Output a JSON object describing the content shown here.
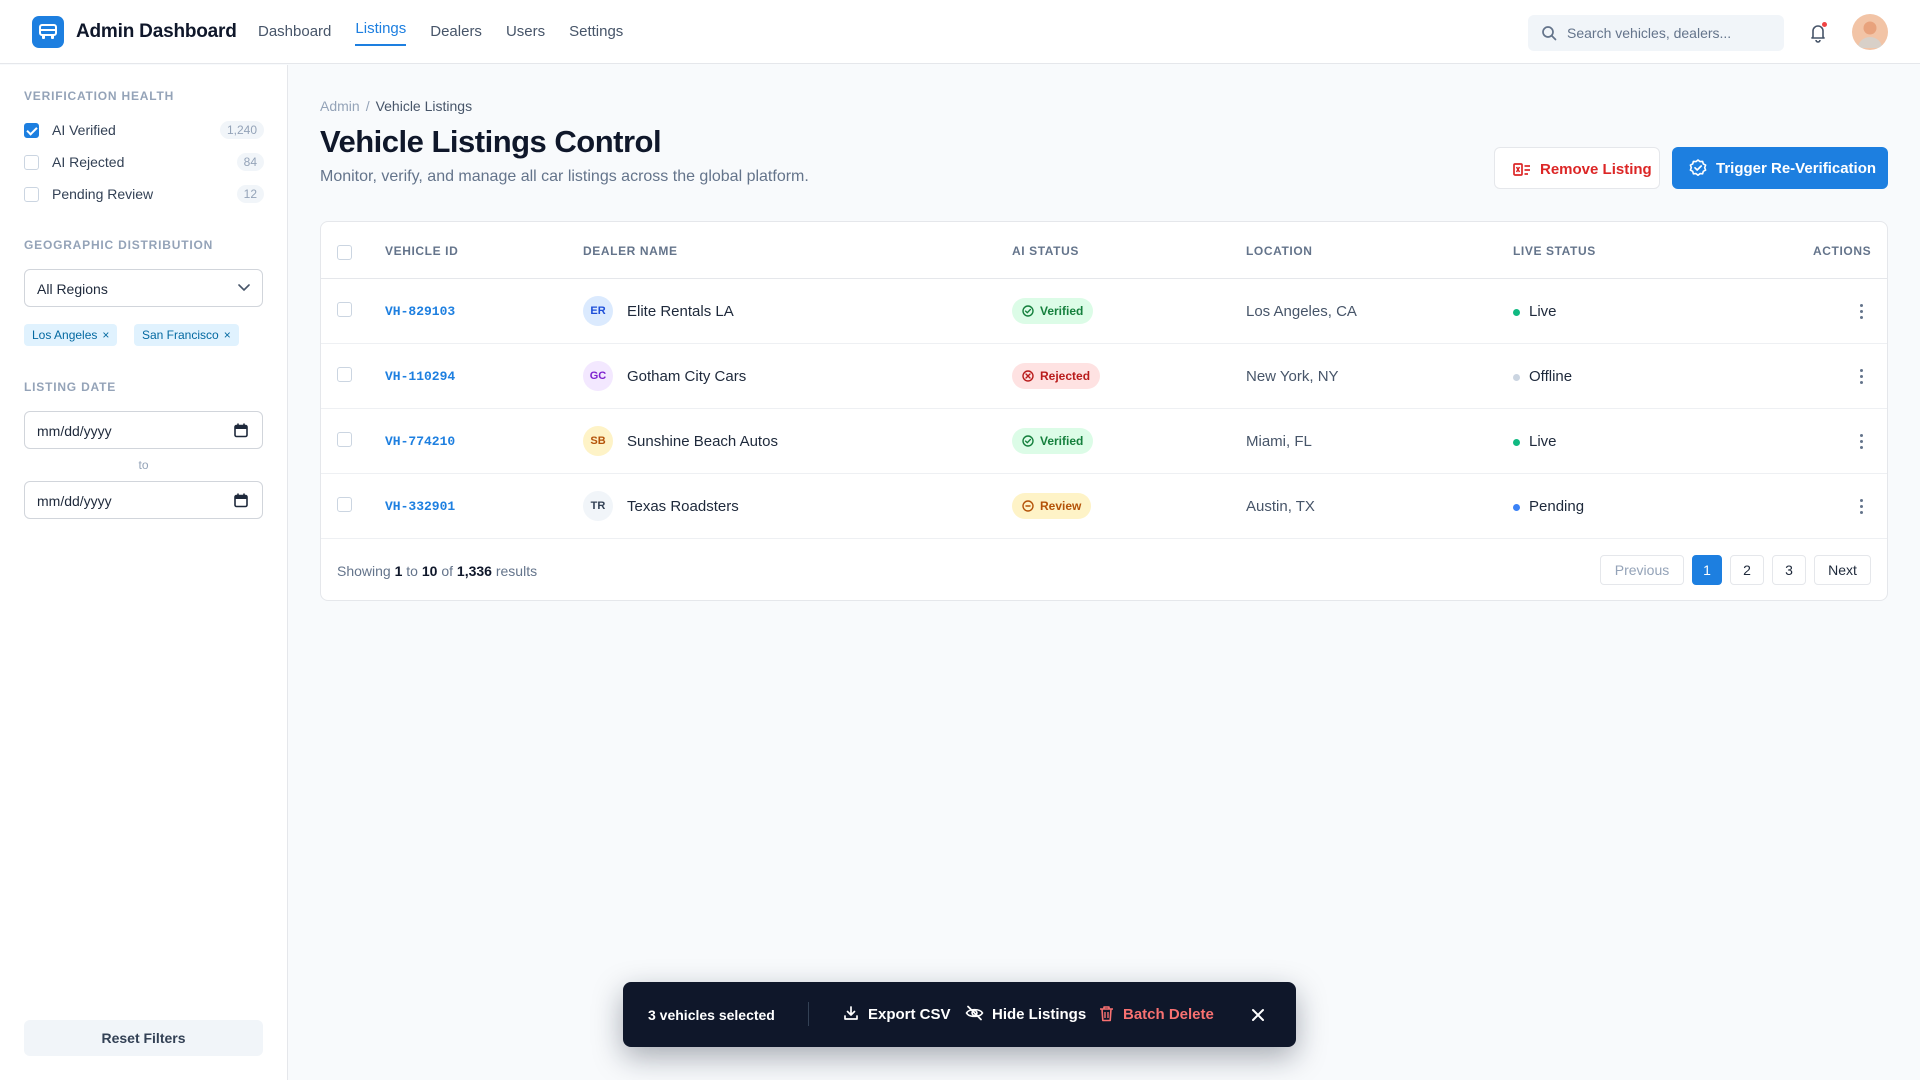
{
  "app": {
    "title": "Admin Dashboard",
    "nav": [
      "Dashboard",
      "Listings",
      "Dealers",
      "Users",
      "Settings"
    ],
    "active_nav": "Listings",
    "search_placeholder": "Search vehicles, dealers..."
  },
  "sidebar": {
    "verification_title": "VERIFICATION HEALTH",
    "filters": [
      {
        "label": "AI Verified",
        "count": "1,240",
        "checked": true
      },
      {
        "label": "AI Rejected",
        "count": "84",
        "checked": false
      },
      {
        "label": "Pending Review",
        "count": "12",
        "checked": false
      }
    ],
    "geo_title": "GEOGRAPHIC DISTRIBUTION",
    "region_select": "All Regions",
    "chips": [
      "Los Angeles",
      "San Francisco"
    ],
    "date_title": "LISTING DATE",
    "date_from": "mm/dd/yyyy",
    "date_to": "mm/dd/yyyy",
    "to_label": "to",
    "reset_label": "Reset Filters"
  },
  "main": {
    "breadcrumb": [
      "Admin",
      "Vehicle Listings"
    ],
    "title": "Vehicle Listings Control",
    "subtitle": "Monitor, verify, and manage all car listings across the global platform.",
    "remove_label": "Remove Listing",
    "trigger_label": "Trigger Re-Verification"
  },
  "table": {
    "headers": [
      "VEHICLE ID",
      "DEALER NAME",
      "AI STATUS",
      "LOCATION",
      "LIVE STATUS",
      "ACTIONS"
    ],
    "rows": [
      {
        "id": "VH-829103",
        "initials": "ER",
        "dealer": "Elite Rentals LA",
        "ai_status": "Verified",
        "location": "Los Angeles, CA",
        "live": "Live"
      },
      {
        "id": "VH-110294",
        "initials": "GC",
        "dealer": "Gotham City Cars",
        "ai_status": "Rejected",
        "location": "New York, NY",
        "live": "Offline"
      },
      {
        "id": "VH-774210",
        "initials": "SB",
        "dealer": "Sunshine Beach Autos",
        "ai_status": "Verified",
        "location": "Miami, FL",
        "live": "Live"
      },
      {
        "id": "VH-332901",
        "initials": "TR",
        "dealer": "Texas Roadsters",
        "ai_status": "Review",
        "location": "Austin, TX",
        "live": "Pending"
      }
    ],
    "footer": {
      "prefix": "Showing",
      "from": "1",
      "to_word": "to",
      "to": "10",
      "of_word": "of",
      "total": "1,336",
      "suffix": "results"
    },
    "pagination": {
      "previous": "Previous",
      "pages": [
        "1",
        "2",
        "3"
      ],
      "next": "Next",
      "current": "1"
    }
  },
  "action_bar": {
    "selected_text": "3 vehicles selected",
    "export_label": "Export CSV",
    "hide_label": "Hide Listings",
    "delete_label": "Batch Delete"
  },
  "colors": {
    "accent": "#1d7fe0",
    "verified_bg": "#dcfce7",
    "verified_fg": "#15803d",
    "rejected_bg": "#fee2e2",
    "rejected_fg": "#b91c1c",
    "review_bg": "#fef3c7",
    "review_fg": "#b45309",
    "live_dot": "#10b981",
    "offline_dot": "#cbd5e1",
    "pending_dot": "#3b82f6",
    "danger": "#dc2626"
  }
}
